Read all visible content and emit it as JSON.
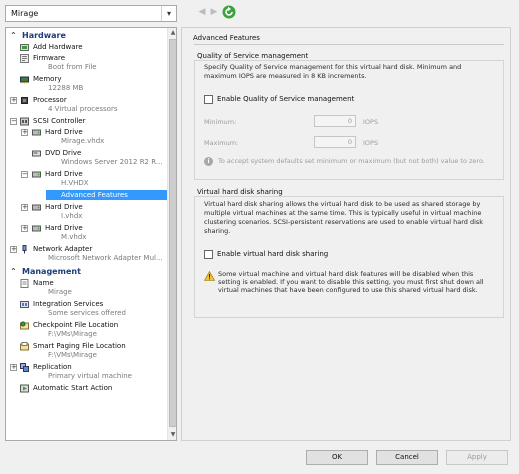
{
  "toolbar": {
    "vm_name": "Mirage",
    "back_glyph": "◀",
    "forward_glyph": "▶",
    "dropdown_glyph": "▾"
  },
  "sections": {
    "hardware": "Hardware",
    "management": "Management",
    "chevron": "⌃"
  },
  "hardware": {
    "add_hardware": {
      "label": "Add Hardware"
    },
    "firmware": {
      "label": "Firmware",
      "sub": "Boot from File"
    },
    "memory": {
      "label": "Memory",
      "sub": "12288 MB"
    },
    "processor": {
      "label": "Processor",
      "sub": "4 Virtual processors"
    },
    "scsi_controller": {
      "label": "SCSI Controller"
    },
    "hard_drive_1": {
      "label": "Hard Drive",
      "sub": "Mirage.vhdx"
    },
    "dvd_drive": {
      "label": "DVD Drive",
      "sub": "Windows Server 2012 R2 R..."
    },
    "hard_drive_2": {
      "label": "Hard Drive",
      "sub": "H.VHDX"
    },
    "advanced_features": {
      "label": "Advanced Features"
    },
    "hard_drive_3": {
      "label": "Hard Drive",
      "sub": "I.vhdx"
    },
    "hard_drive_4": {
      "label": "Hard Drive",
      "sub": "M.vhdx"
    },
    "network_adapter": {
      "label": "Network Adapter",
      "sub": "Microsoft Network Adapter Mul..."
    }
  },
  "management": {
    "name": {
      "label": "Name",
      "sub": "Mirage"
    },
    "integration_services": {
      "label": "Integration Services",
      "sub": "Some services offered"
    },
    "checkpoint_location": {
      "label": "Checkpoint File Location",
      "sub": "F:\\VMs\\Mirage"
    },
    "smart_paging": {
      "label": "Smart Paging File Location",
      "sub": "F:\\VMs\\Mirage"
    },
    "replication": {
      "label": "Replication",
      "sub": "Primary virtual machine"
    },
    "automatic_start": {
      "label": "Automatic Start Action"
    }
  },
  "detail": {
    "title": "Advanced Features",
    "qos": {
      "title": "Quality of Service management",
      "description": "Specify Quality of Service management for this virtual hard disk. Minimum and maximum IOPS are measured in 8 KB increments.",
      "enable_label": "Enable Quality of Service management",
      "minimum_label": "Minimum:",
      "minimum_value": "0",
      "maximum_label": "Maximum:",
      "maximum_value": "0",
      "unit": "IOPS",
      "info_glyph": "i",
      "info_text": "To accept system defaults set minimum or maximum (but not both) value to zero."
    },
    "sharing": {
      "title": "Virtual hard disk sharing",
      "description": "Virtual hard disk sharing allows the virtual hard disk to be used as shared storage by multiple virtual machines at the same time. This is typically useful in virtual machine clustering scenarios. SCSI-persistent reservations are used to enable virtual hard disk sharing.",
      "enable_label": "Enable virtual hard disk sharing",
      "warning_text": "Some virtual machine and virtual hard disk features will be disabled when this setting is enabled. If you want to disable this setting, you must first shut down all virtual machines that have been configured to use this shared virtual hard disk."
    }
  },
  "buttons": {
    "ok": "OK",
    "cancel": "Cancel",
    "apply": "Apply"
  },
  "scrollbar": {
    "up_glyph": "▲",
    "down_glyph": "▼"
  },
  "colors": {
    "selection": "#3399ff",
    "section_header": "#1c3d78",
    "refresh_green": "#3aa33a"
  }
}
